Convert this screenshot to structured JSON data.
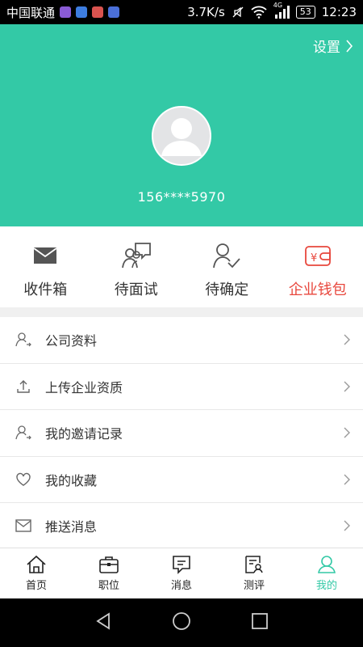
{
  "status_bar": {
    "carrier": "中国联通",
    "speed": "3.7K/s",
    "network_label": "4G",
    "battery": "53",
    "time": "12:23"
  },
  "header": {
    "settings_label": "设置",
    "phone": "156****5970",
    "background_color": "#33c9a6"
  },
  "actions": [
    {
      "label": "收件箱",
      "icon": "envelope-icon"
    },
    {
      "label": "待面试",
      "icon": "chat-person-icon"
    },
    {
      "label": "待确定",
      "icon": "person-check-icon"
    },
    {
      "label": "企业钱包",
      "icon": "wallet-icon",
      "color": "#e8473d"
    }
  ],
  "menu": [
    {
      "label": "公司资料",
      "icon": "person-icon"
    },
    {
      "label": "上传企业资质",
      "icon": "upload-icon"
    },
    {
      "label": "我的邀请记录",
      "icon": "person-icon"
    },
    {
      "label": "我的收藏",
      "icon": "heart-icon"
    },
    {
      "label": "推送消息",
      "icon": "mail-icon"
    }
  ],
  "bottom_nav": [
    {
      "label": "首页",
      "icon": "home-icon"
    },
    {
      "label": "职位",
      "icon": "briefcase-icon"
    },
    {
      "label": "消息",
      "icon": "message-icon"
    },
    {
      "label": "测评",
      "icon": "assessment-icon"
    },
    {
      "label": "我的",
      "icon": "profile-icon",
      "active": true
    }
  ]
}
